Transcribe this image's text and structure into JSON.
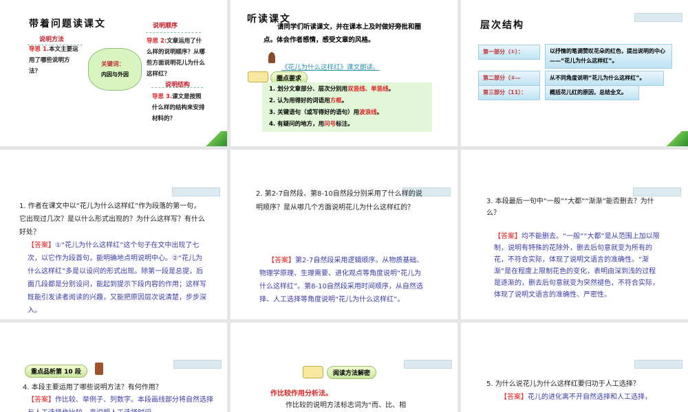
{
  "slide1": {
    "title": "带着问题读课文",
    "method_label": "说明方法",
    "q1_tag": "导思 1.",
    "q1": "本文主要运用了哪些说明方法？",
    "order_label": "说明顺序",
    "q2_tag": "导思 2:",
    "q2": "文章运用了什么样的说明顺序？从哪些方面说明花儿为什么这样红？",
    "keyword_label": "关键词：",
    "keyword": "内因与外因",
    "structure_label": "说明结构",
    "q3_tag": "导思 3.",
    "q3": "课文是按照什么样的结构来安排材料的？"
  },
  "slide2": {
    "title": "听读课文",
    "intro": "请同学们听读课文，并在课本上及时做好旁批和圈点。体会作者感情，感受文章的风格。",
    "link": "《花儿为什么这样红》课文朗读。",
    "req_label": "圈点要求",
    "items": [
      {
        "pre": "1. 划分文章部分、层次分别用",
        "hl": "双竖线、单竖线",
        "post": "。"
      },
      {
        "pre": "2. 认为用得好的词语用",
        "hl": "方框",
        "post": "。"
      },
      {
        "pre": "3. 关键语句（或写得好的语句）用",
        "hl": "波浪线",
        "post": "。"
      },
      {
        "pre": "4. 有疑问的地方，用",
        "hl": "问号",
        "post": "标注。"
      }
    ]
  },
  "slide3": {
    "title": "层次结构",
    "parts": [
      {
        "label": "第一部分（①）：",
        "desc": "以抒情的笔调赞叹花朵的红色，提出说明的中心——“花儿为什么这样红”。"
      },
      {
        "label": "第二部分（②—",
        "desc": "从不同角度说明“花儿为什么这样红”。"
      },
      {
        "label": "第三部分（11）：",
        "desc": "概括花儿红的原因，总结全文。"
      }
    ]
  },
  "slide4": {
    "question": "1. 作者在课文中以“花儿为什么这样红”作为段落的第一句，它出现过几次？是以什么形式出现的？为什么这样写？有什么好处？",
    "ans_tag": "【答案】",
    "answer": "①“花儿为什么这样红”这个句子在文中出现了七次，以它作为段首句，能明确地点明说明中心。②“花儿为什么这样红”多是以设问的形式出现。除第一段是总提，后面几段都是分别设问，能起到提示下段内容的作用；这样写既能引发读者阅读的兴趣，又能把原因层次说清楚，步步深入。"
  },
  "slide5": {
    "question": "2. 第2-7自然段、第8-10自然段分别采用了什么样的说明顺序？是从哪几个方面说明花儿为什么这样红的？",
    "ans_tag": "【答案】",
    "answer": "第2-7自然段采用逻辑顺序。从物质基础、物理学原理、生理需要、进化观点等角度说明“花儿为什么这样红”。第8-10自然段采用时间顺序，从自然选择、人工选择等角度说明“花儿为什么这样红”。"
  },
  "slide6": {
    "question": "3. 本段最后一句中“一般”“大都”“渐渐”能否删去？为什么？",
    "ans_tag": "【答案】",
    "answer": "均不能删去。“一般”“大都”是从范围上加以限制，说明有特殊的花除外，删去后句意就变为所有的花，不符合实际，体现了说明文语言的准确性。“渐渐”是在程度上限制花色的变化，表明由深到浅的过程是逐渐的，删去后句意就变为突然褪色，不符合实际，体现了说明文语言的准确性、严密性。"
  },
  "slide7": {
    "badge": "重点品析第 10 段",
    "question": "4. 本段主要运用了哪些说明方法？有何作用？",
    "ans_tag": "【答案】",
    "answer": "作比较、举例子、列数字。本段画线部分将自然选择与人工选择作比较，来说明人工选择时间"
  },
  "slide8": {
    "badge": "阅读方法解密",
    "method": "作比较作用分析法。",
    "line": "作比较的说明方法标志词为“而、比、相"
  },
  "slide9": {
    "question": "5. 为什么说花儿为什么这样红要归功于人工选择？",
    "ans_tag": "【答案】",
    "answer": "花儿的进化离不开自然选择和人工选择，"
  }
}
